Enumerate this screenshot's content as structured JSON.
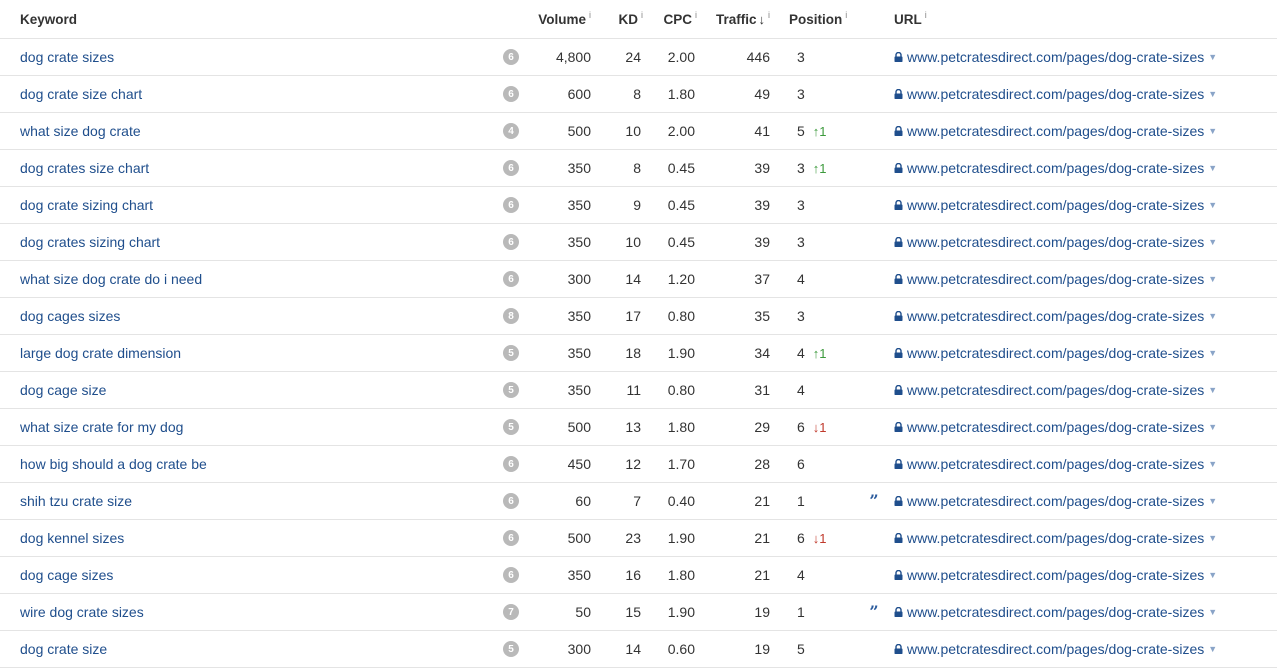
{
  "header": {
    "keyword": "Keyword",
    "volume": "Volume",
    "kd": "KD",
    "cpc": "CPC",
    "traffic": "Traffic",
    "position": "Position",
    "url": "URL",
    "info": "i",
    "sort_arrow": "↓"
  },
  "rows": [
    {
      "keyword": "dog crate sizes",
      "serp_features": "6",
      "volume": "4,800",
      "kd": "24",
      "cpc": "2.00",
      "traffic": "446",
      "position": "3",
      "change": "",
      "change_dir": "",
      "featured": false,
      "url": "www.petcratesdirect.com/pages/dog-crate-sizes"
    },
    {
      "keyword": "dog crate size chart",
      "serp_features": "6",
      "volume": "600",
      "kd": "8",
      "cpc": "1.80",
      "traffic": "49",
      "position": "3",
      "change": "",
      "change_dir": "",
      "featured": false,
      "url": "www.petcratesdirect.com/pages/dog-crate-sizes"
    },
    {
      "keyword": "what size dog crate",
      "serp_features": "4",
      "volume": "500",
      "kd": "10",
      "cpc": "2.00",
      "traffic": "41",
      "position": "5",
      "change": "↑1",
      "change_dir": "up",
      "featured": false,
      "url": "www.petcratesdirect.com/pages/dog-crate-sizes"
    },
    {
      "keyword": "dog crates size chart",
      "serp_features": "6",
      "volume": "350",
      "kd": "8",
      "cpc": "0.45",
      "traffic": "39",
      "position": "3",
      "change": "↑1",
      "change_dir": "up",
      "featured": false,
      "url": "www.petcratesdirect.com/pages/dog-crate-sizes"
    },
    {
      "keyword": "dog crate sizing chart",
      "serp_features": "6",
      "volume": "350",
      "kd": "9",
      "cpc": "0.45",
      "traffic": "39",
      "position": "3",
      "change": "",
      "change_dir": "",
      "featured": false,
      "url": "www.petcratesdirect.com/pages/dog-crate-sizes"
    },
    {
      "keyword": "dog crates sizing chart",
      "serp_features": "6",
      "volume": "350",
      "kd": "10",
      "cpc": "0.45",
      "traffic": "39",
      "position": "3",
      "change": "",
      "change_dir": "",
      "featured": false,
      "url": "www.petcratesdirect.com/pages/dog-crate-sizes"
    },
    {
      "keyword": "what size dog crate do i need",
      "serp_features": "6",
      "volume": "300",
      "kd": "14",
      "cpc": "1.20",
      "traffic": "37",
      "position": "4",
      "change": "",
      "change_dir": "",
      "featured": false,
      "url": "www.petcratesdirect.com/pages/dog-crate-sizes"
    },
    {
      "keyword": "dog cages sizes",
      "serp_features": "8",
      "volume": "350",
      "kd": "17",
      "cpc": "0.80",
      "traffic": "35",
      "position": "3",
      "change": "",
      "change_dir": "",
      "featured": false,
      "url": "www.petcratesdirect.com/pages/dog-crate-sizes"
    },
    {
      "keyword": "large dog crate dimension",
      "serp_features": "5",
      "volume": "350",
      "kd": "18",
      "cpc": "1.90",
      "traffic": "34",
      "position": "4",
      "change": "↑1",
      "change_dir": "up",
      "featured": false,
      "url": "www.petcratesdirect.com/pages/dog-crate-sizes"
    },
    {
      "keyword": "dog cage size",
      "serp_features": "5",
      "volume": "350",
      "kd": "11",
      "cpc": "0.80",
      "traffic": "31",
      "position": "4",
      "change": "",
      "change_dir": "",
      "featured": false,
      "url": "www.petcratesdirect.com/pages/dog-crate-sizes"
    },
    {
      "keyword": "what size crate for my dog",
      "serp_features": "5",
      "volume": "500",
      "kd": "13",
      "cpc": "1.80",
      "traffic": "29",
      "position": "6",
      "change": "↓1",
      "change_dir": "down",
      "featured": false,
      "url": "www.petcratesdirect.com/pages/dog-crate-sizes"
    },
    {
      "keyword": "how big should a dog crate be",
      "serp_features": "6",
      "volume": "450",
      "kd": "12",
      "cpc": "1.70",
      "traffic": "28",
      "position": "6",
      "change": "",
      "change_dir": "",
      "featured": false,
      "url": "www.petcratesdirect.com/pages/dog-crate-sizes"
    },
    {
      "keyword": "shih tzu crate size",
      "serp_features": "6",
      "volume": "60",
      "kd": "7",
      "cpc": "0.40",
      "traffic": "21",
      "position": "1",
      "change": "",
      "change_dir": "",
      "featured": true,
      "url": "www.petcratesdirect.com/pages/dog-crate-sizes"
    },
    {
      "keyword": "dog kennel sizes",
      "serp_features": "6",
      "volume": "500",
      "kd": "23",
      "cpc": "1.90",
      "traffic": "21",
      "position": "6",
      "change": "↓1",
      "change_dir": "down",
      "featured": false,
      "url": "www.petcratesdirect.com/pages/dog-crate-sizes"
    },
    {
      "keyword": "dog cage sizes",
      "serp_features": "6",
      "volume": "350",
      "kd": "16",
      "cpc": "1.80",
      "traffic": "21",
      "position": "4",
      "change": "",
      "change_dir": "",
      "featured": false,
      "url": "www.petcratesdirect.com/pages/dog-crate-sizes"
    },
    {
      "keyword": "wire dog crate sizes",
      "serp_features": "7",
      "volume": "50",
      "kd": "15",
      "cpc": "1.90",
      "traffic": "19",
      "position": "1",
      "change": "",
      "change_dir": "",
      "featured": true,
      "url": "www.petcratesdirect.com/pages/dog-crate-sizes"
    },
    {
      "keyword": "dog crate size",
      "serp_features": "5",
      "volume": "300",
      "kd": "14",
      "cpc": "0.60",
      "traffic": "19",
      "position": "5",
      "change": "",
      "change_dir": "",
      "featured": false,
      "url": "www.petcratesdirect.com/pages/dog-crate-sizes"
    }
  ],
  "icons": {
    "featured_snippet": "quote-icon",
    "secure": "lock-icon",
    "dropdown": "caret-down-icon"
  },
  "colors": {
    "link": "#1f4e8c",
    "up": "#3c9a3c",
    "down": "#c0392b",
    "badge": "#b9b9b9"
  }
}
